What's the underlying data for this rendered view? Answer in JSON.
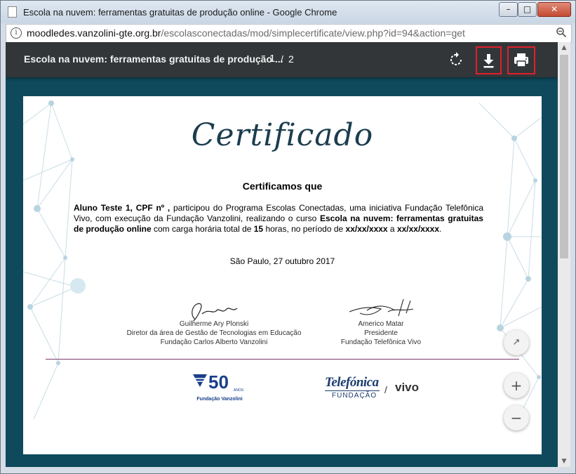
{
  "window": {
    "title": "Escola na nuvem: ferramentas gratuitas de produção online - Google Chrome",
    "min_symbol": "–",
    "max_symbol": "□",
    "close_symbol": "✕"
  },
  "address": {
    "host": "moodledes.vanzolini-gte.org.br",
    "path": "/escolasconectadas/mod/simplecertificate/view.php?id=94&action=get",
    "info_icon": "i"
  },
  "pdf_toolbar": {
    "doc_title": "Escola na nuvem: ferramentas gratuitas de produção ...",
    "page_current": "1",
    "page_sep": "/",
    "page_total": "2"
  },
  "certificate": {
    "title": "Certificado",
    "subtitle": "Certificamos que",
    "body": {
      "student": "Aluno Teste 1, CPF nº ,",
      "t1": " participou do Programa Escolas Conectadas, uma iniciativa Fundação Telefônica Vivo, com execução da Fundação Vanzolini, realizando o curso ",
      "course": "Escola na nuvem: ferramentas gratuitas de produção online",
      "t2": " com carga horária total de ",
      "hours": "15",
      "t3": " horas, no período de ",
      "start": "xx/xx/xxxx",
      "t4": " a ",
      "end": "xx/xx/xxxx",
      "t5": "."
    },
    "date_line": "São Paulo, 27 outubro 2017",
    "signatures": [
      {
        "name": "Guilherme Ary Plonski",
        "role": "Diretor da área de Gestão de Tecnologias em Educação",
        "org": "Fundação Carlos Alberto Vanzolini"
      },
      {
        "name": "Americo Matar",
        "role": "Presidente",
        "org": "Fundação Telefônica Vivo"
      }
    ],
    "logos": {
      "vanzolini_number": "50",
      "vanzolini_anos": "ANOS",
      "vanzolini_caption": "Fundação Vanzolini",
      "telefonica": "Telefónica",
      "telefonica_sub": "FUNDAÇÃO",
      "slash": "/",
      "vivo": "vivo"
    }
  },
  "fabs": {
    "fit": "↗",
    "zoom_in": "+",
    "zoom_out": "−"
  },
  "scrollbar": {
    "up": "▲",
    "down": "▼"
  },
  "colors": {
    "toolbar": "#323639",
    "page_bg": "#0e4a5c",
    "highlight": "#e0202a",
    "cert_title": "#1c3d4e"
  },
  "icons": [
    "rotate-icon",
    "download-icon",
    "print-icon",
    "fit-page-icon",
    "zoom-in-icon",
    "zoom-out-icon",
    "search-zoom-icon",
    "info-icon",
    "page-icon"
  ]
}
